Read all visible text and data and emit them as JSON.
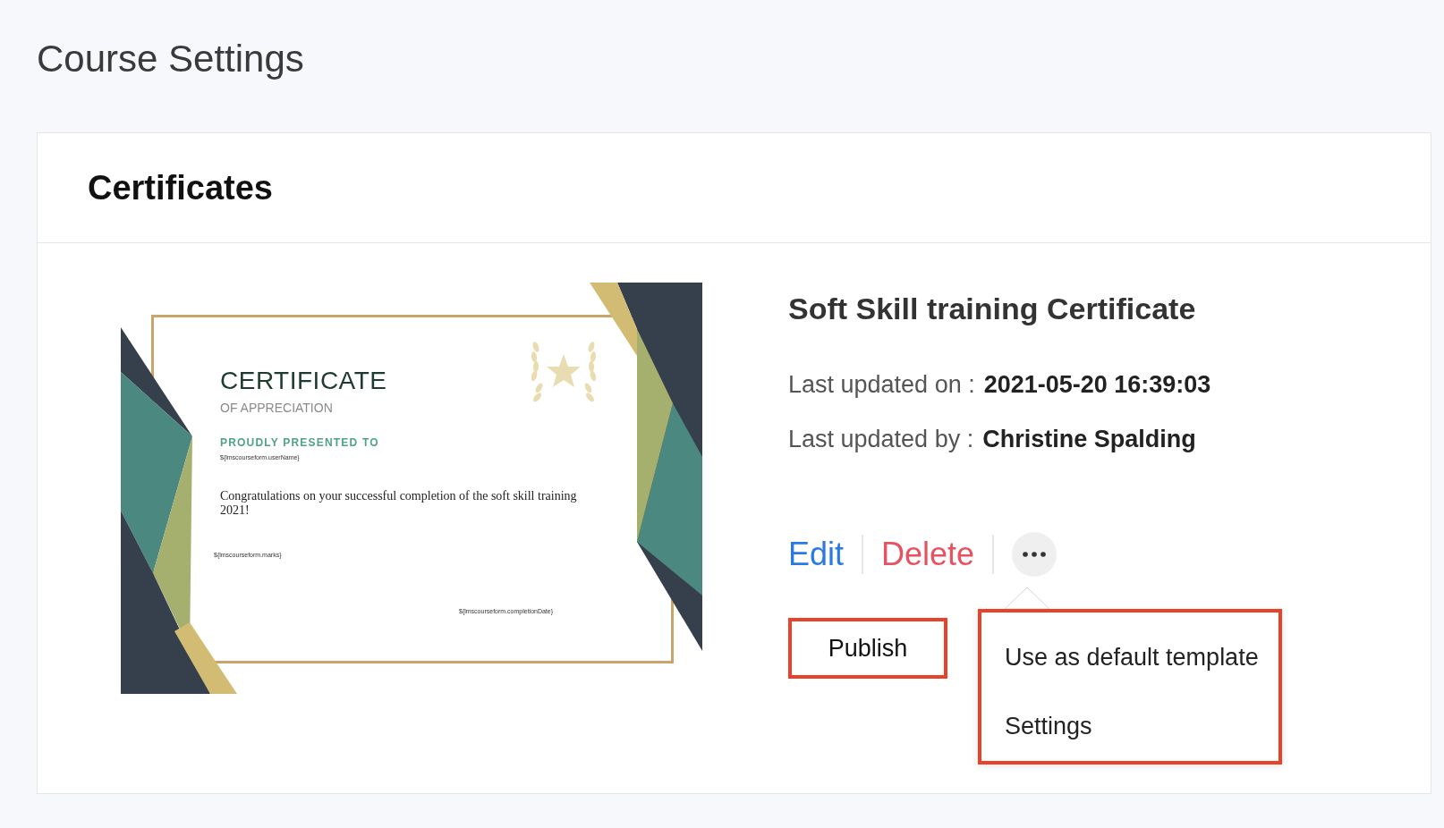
{
  "page_title": "Course Settings",
  "section": {
    "title": "Certificates"
  },
  "certificate": {
    "preview": {
      "heading": "CERTIFICATE",
      "subheading": "OF APPRECIATION",
      "presented_label": "PROUDLY PRESENTED TO",
      "name_field": "${lmscourseform.userName}",
      "message": "Congratulations on your successful completion of the soft skill training 2021!",
      "marks_field": "${lmscourseform.marks}",
      "date_field": "${lmscourseform.completionDate}"
    },
    "name": "Soft Skill training Certificate",
    "details": [
      {
        "label": "Last updated on :",
        "value": "2021-05-20 16:39:03"
      },
      {
        "label": "Last updated by :",
        "value": "Christine Spalding"
      }
    ],
    "actions": [
      {
        "kind": "edit",
        "label": "Edit"
      },
      {
        "kind": "delete",
        "label": "Delete"
      },
      {
        "kind": "more"
      }
    ],
    "publish": {
      "label": "Publish",
      "highlighted": true
    },
    "menu": {
      "open": true,
      "highlighted": true,
      "items": [
        "Use as default template",
        "Settings"
      ]
    }
  }
}
